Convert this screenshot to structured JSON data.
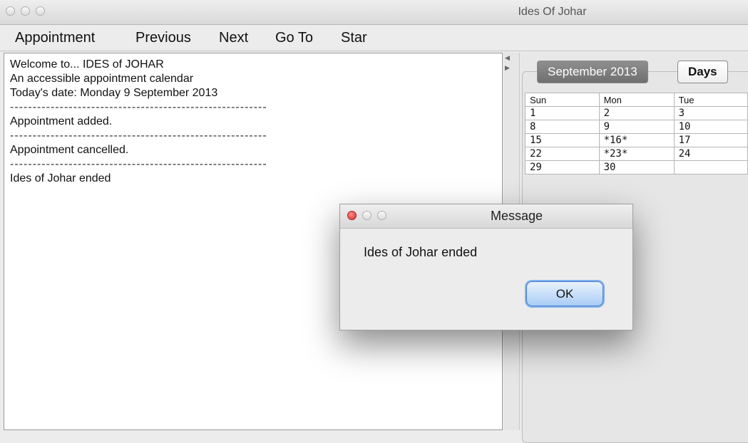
{
  "window": {
    "title": "Ides Of Johar"
  },
  "menu": [
    "Appointment",
    "Previous",
    "Next",
    "Go To",
    "Star"
  ],
  "log": {
    "lines": [
      "Welcome to... IDES of JOHAR",
      "An accessible appointment calendar",
      "Today's date:  Monday 9 September 2013",
      "---------------------------------------------------------",
      "Appointment added.",
      "---------------------------------------------------------",
      "Appointment cancelled.",
      "---------------------------------------------------------",
      "Ides of Johar ended"
    ]
  },
  "tabs": {
    "active": "September 2013",
    "inactive": "Days"
  },
  "calendar": {
    "headers": [
      "Sun",
      "Mon",
      "Tue"
    ],
    "rows": [
      [
        "1",
        "2",
        "3"
      ],
      [
        "8",
        "9",
        "10"
      ],
      [
        "15",
        "*16*",
        "17"
      ],
      [
        "22",
        "*23*",
        "24"
      ],
      [
        "29",
        "30",
        ""
      ]
    ]
  },
  "dialog": {
    "title": "Message",
    "message": "Ides of Johar ended",
    "ok_label": "OK"
  },
  "colors": {
    "accent": "#7fb0ee",
    "close_button": "#e0443e"
  }
}
